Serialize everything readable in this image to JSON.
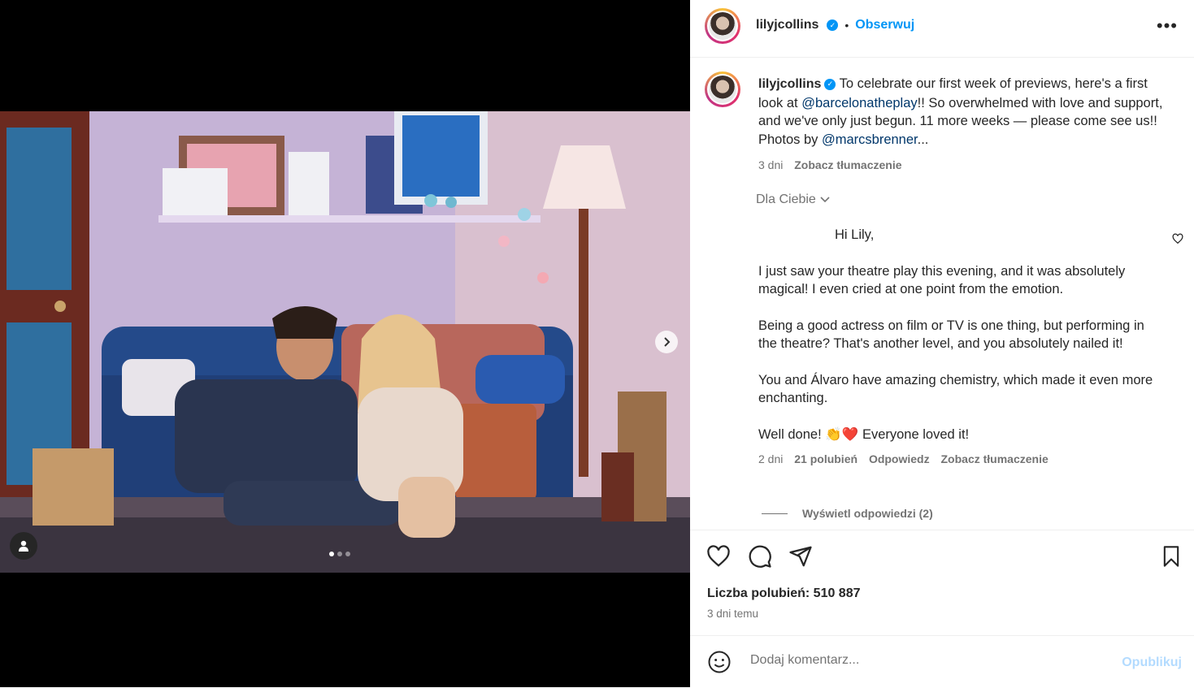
{
  "post": {
    "username": "lilyjcollins",
    "follow_separator": "•",
    "follow_label": "Obserwuj",
    "more_label": "•••"
  },
  "caption": {
    "username": "lilyjcollins",
    "text_1": "To celebrate our first week of previews, here's a first look at",
    "mention_1": "@barcelonatheplay",
    "text_2": "!! So overwhelmed with love and support, and we've only just begun. 11 more weeks — please come see us!! Photos by",
    "mention_2": "@marcsbrenner",
    "ellipsis": "...",
    "age": "3 dni",
    "translate": "Zobacz tłumaczenie"
  },
  "comments_filter": {
    "label": "Dla Ciebie"
  },
  "comment": {
    "greeting": "Hi Lily,",
    "p1": "I just saw your theatre play this evening, and it was absolutely magical! I even cried at one point from the emotion.",
    "p2": "Being a good actress on film or TV is one thing, but performing in the theatre? That's another level, and you absolutely nailed it!",
    "p3": "You and Álvaro have amazing chemistry, which made it even more enchanting.",
    "p4_text": "Well done!",
    "p4_emoji": "👏❤️",
    "p4_end": "Everyone loved it!",
    "age": "2 dni",
    "likes": "21 polubień",
    "reply": "Odpowiedz",
    "translate": "Zobacz tłumaczenie",
    "view_replies": "Wyświetl odpowiedzi (2)"
  },
  "footer": {
    "likes_label": "Liczba polubień: 510 887",
    "time": "3 dni temu",
    "comment_placeholder": "Dodaj komentarz...",
    "publish": "Opublikuj"
  },
  "carousel": {
    "slide_count": 3,
    "active_slide": 1
  },
  "colors": {
    "accent": "#0095f6",
    "link": "#00376b",
    "muted": "#737373"
  }
}
